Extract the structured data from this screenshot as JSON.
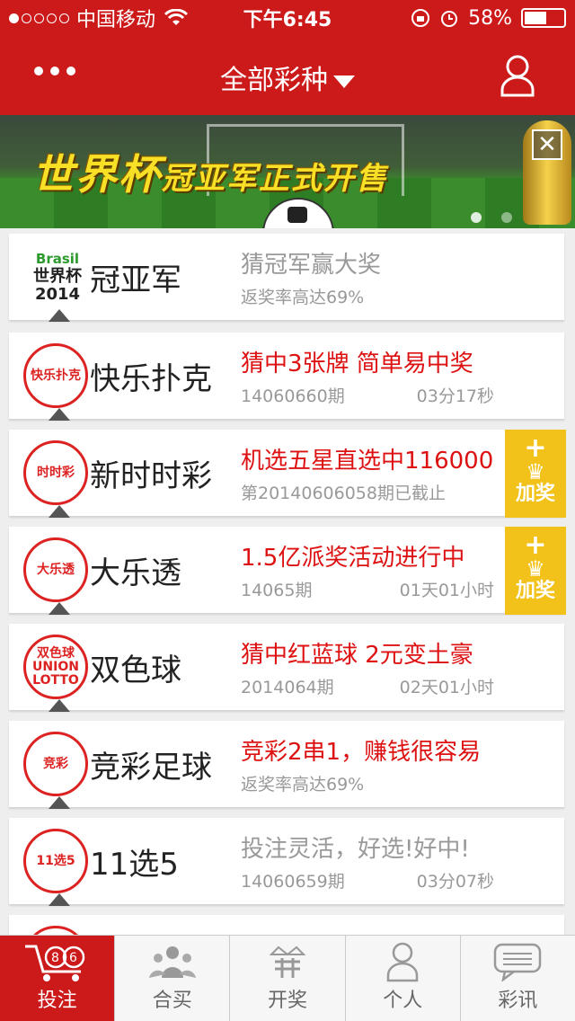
{
  "status_bar": {
    "carrier": "中国移动",
    "time": "下午6:45",
    "battery": "58%",
    "battery_level": 0.58
  },
  "nav": {
    "title": "全部彩种"
  },
  "banner": {
    "title": "世界杯",
    "subtitle": "冠亚军正式开售",
    "close_symbol": "✕"
  },
  "lottery_items": [
    {
      "logo_text": "Brasil 世界杯 2014",
      "logo_top": "Brasil",
      "logo_mid": "世界杯",
      "logo_bot": "2014",
      "name": "冠亚军",
      "title": "猜冠军赢大奖",
      "title_style": "gray",
      "sub": "返奖率高达69%",
      "time": ""
    },
    {
      "logo_text": "快乐扑克",
      "name": "快乐扑克",
      "title": "猜中3张牌 简单易中奖",
      "title_style": "red",
      "sub": "14060660期",
      "time": "03分17秒"
    },
    {
      "logo_text": "时时彩",
      "name": "新时时彩",
      "title": "机选五星直选中116000",
      "title_style": "red",
      "sub": "第20140606058期已截止",
      "time": "",
      "bonus": "加奖"
    },
    {
      "logo_text": "大乐透",
      "name": "大乐透",
      "title": "1.5亿派奖活动进行中",
      "title_style": "red",
      "sub": "14065期",
      "time": "01天01小时",
      "bonus": "加奖"
    },
    {
      "logo_text": "双色球 UNION LOTTO",
      "name": "双色球",
      "title": "猜中红蓝球 2元变土豪",
      "title_style": "red",
      "sub": "2014064期",
      "time": "02天01小时"
    },
    {
      "logo_text": "竞彩",
      "name": "竞彩足球",
      "title": "竞彩2串1，赚钱很容易",
      "title_style": "red",
      "sub": "返奖率高达69%",
      "time": ""
    },
    {
      "logo_text": "11选5",
      "name": "11选5",
      "title": "投注灵活，好选!好中!",
      "title_style": "gray",
      "sub": "14060659期",
      "time": "03分07秒"
    }
  ],
  "tabs": [
    {
      "label": "投注",
      "icon": "cart-icon",
      "active": true
    },
    {
      "label": "合买",
      "icon": "group-icon",
      "active": false
    },
    {
      "label": "开奖",
      "icon": "crown-icon",
      "active": false
    },
    {
      "label": "个人",
      "icon": "person-icon",
      "active": false
    },
    {
      "label": "彩讯",
      "icon": "message-icon",
      "active": false
    }
  ],
  "colors": {
    "brand_red": "#cc1a1a",
    "accent_red": "#dd1111",
    "bonus_gold": "#f2c21b"
  }
}
